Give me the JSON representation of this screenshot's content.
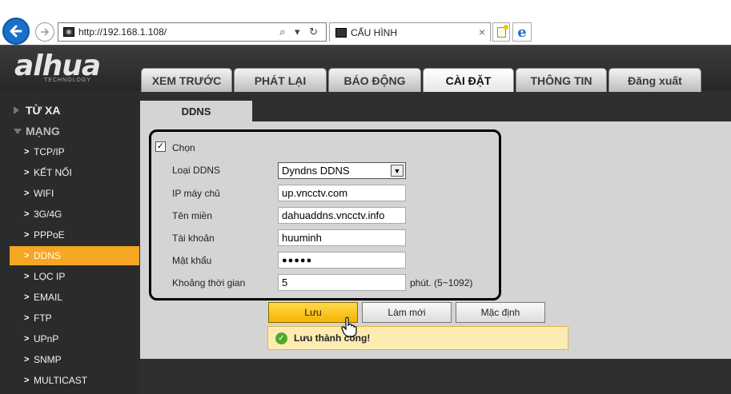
{
  "browser": {
    "url": "http://192.168.1.108/",
    "address_tools": "⌕ ▾ ↻",
    "tab_title": "CẤU HÌNH",
    "tab_close": "×"
  },
  "header": {
    "logo_text": "alhua",
    "logo_sub": "TECHNOLOGY",
    "nav": [
      {
        "label": "XEM TRƯỚC"
      },
      {
        "label": "PHÁT LẠI"
      },
      {
        "label": "BÁO ĐỘNG"
      },
      {
        "label": "CÀI ĐẶT"
      },
      {
        "label": "THÔNG TIN"
      },
      {
        "label": "Đăng xuất"
      }
    ]
  },
  "sidebar": {
    "sections": [
      {
        "label": "TỪ XA"
      },
      {
        "label": "MẠNG"
      }
    ],
    "items": [
      {
        "label": "TCP/IP"
      },
      {
        "label": "KẾT NỐI"
      },
      {
        "label": "WIFI"
      },
      {
        "label": "3G/4G"
      },
      {
        "label": "PPPoE"
      },
      {
        "label": "DDNS"
      },
      {
        "label": "LỌC IP"
      },
      {
        "label": "EMAIL"
      },
      {
        "label": "FTP"
      },
      {
        "label": "UPnP"
      },
      {
        "label": "SNMP"
      },
      {
        "label": "MULTICAST"
      }
    ]
  },
  "content": {
    "tab": "DDNS",
    "enable_label": "Chọn",
    "enable_checked": "✓",
    "fields": {
      "type_label": "Loại DDNS",
      "type_value": "Dyndns DDNS",
      "server_label": "IP máy chủ",
      "server_value": "up.vncctv.com",
      "domain_label": "Tên miền",
      "domain_value": "dahuaddns.vncctv.info",
      "user_label": "Tài khoản",
      "user_value": "huuminh",
      "password_label": "Mật khẩu",
      "password_value": "●●●●●",
      "interval_label": "Khoảng thời gian",
      "interval_value": "5",
      "interval_unit": "phút. (5~1092)"
    },
    "buttons": {
      "save": "Lưu",
      "refresh": "Làm mới",
      "default": "Mặc định"
    },
    "status_message": "Lưu thành công!"
  }
}
